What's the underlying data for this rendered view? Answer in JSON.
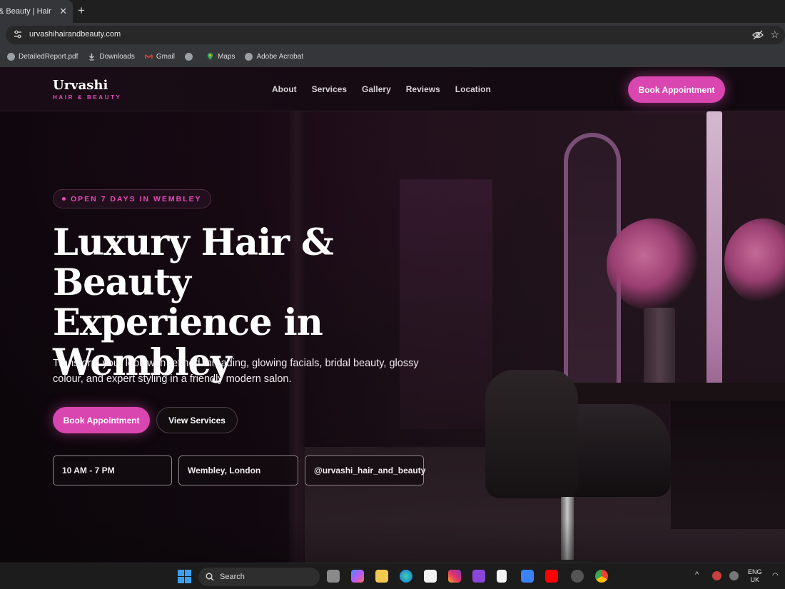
{
  "browser": {
    "tab_title": "& Beauty | Hair Sa",
    "tab_close": "✕",
    "new_tab": "+",
    "url": "urvashihairandbeauty.com",
    "bookmarks": [
      {
        "label": "DetailedReport.pdf",
        "icon": "globe-icon"
      },
      {
        "label": "Downloads",
        "icon": "download-icon"
      },
      {
        "label": "Gmail",
        "icon": "gmail-icon"
      },
      {
        "label": "",
        "icon": "globe-icon"
      },
      {
        "label": "Maps",
        "icon": "maps-icon"
      },
      {
        "label": "Adobe Acrobat",
        "icon": "globe-icon"
      }
    ]
  },
  "site": {
    "brand_name": "Urvashi",
    "brand_sub": "HAIR & BEAUTY",
    "nav": [
      "About",
      "Services",
      "Gallery",
      "Reviews",
      "Location"
    ],
    "cta_top": "Book Appointment",
    "badge": "OPEN 7 DAYS IN WEMBLEY",
    "headline_lines": [
      "Luxury Hair & Beauty",
      "Experience in",
      "Wembley"
    ],
    "subtext": "Transform your look with refined threading, glowing facials, bridal beauty, glossy colour, and expert styling in a friendly modern salon.",
    "primary_button": "Book Appointment",
    "secondary_button": "View Services",
    "info_cards": [
      "10 AM - 7 PM",
      "Wembley, London",
      "@urvashi_hair_and_beauty"
    ],
    "accent_color": "#d946b0"
  },
  "taskbar": {
    "search_label": "Search",
    "language": [
      "ENG",
      "UK"
    ]
  }
}
